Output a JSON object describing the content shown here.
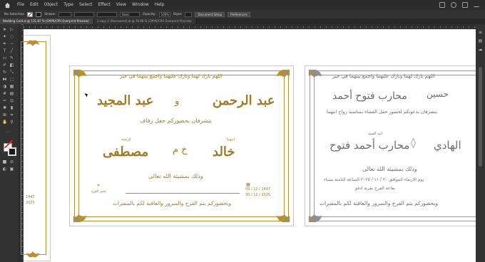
{
  "menubar": {
    "items": [
      "File",
      "Edit",
      "Object",
      "Type",
      "Select",
      "Effect",
      "View",
      "Window",
      "Help"
    ]
  },
  "controlbar": {
    "selection": "No Selection",
    "stroke_label": "Stroke:",
    "style_label": "Basic",
    "opacity_label": "Opacity:",
    "opacity_value": "100%",
    "style2_label": "Style:",
    "doc_setup": "Document Setup",
    "preferences": "Preferences"
  },
  "tabs": [
    "Wedding Card.ai @ 131.87 % (CMYK/CPU Overprint Preview)",
    "3 copy 1 (Recovered).ai @ 76.68 % (CMYK/CPU Overprint Preview)"
  ],
  "card1": {
    "top_verse": "اللهم بارك لهما وبارك عليهما واجمع بينهما في خير",
    "groom_father": "عبد الرحمن",
    "connector": "و",
    "bride_father": "عبد المجيد",
    "invite_line": "يتشرفان بحضوركم حفل زفاف",
    "groom_label": "ابنهما",
    "groom_name": "خالد",
    "bride_label": "كريمته",
    "bride_name": "مصطفى",
    "center_initials": "خ م",
    "blessing": "وذلك بمشيئة الله تعالى",
    "date_hijri": "09 / 12 / 1447",
    "date_greg": "30 / 11 / 2025",
    "location": "قصر الفرح",
    "closing": "وبحضوركم يتم الفرح والسرور والعاقبة لكم بالمسرات"
  },
  "card2": {
    "top_verse": "اللهم بارك لهما وبارك عليهما واجمع بينهما في خير",
    "father1": "محارب فتوح أحمد",
    "father2": "حسين",
    "line1": "يتشرفان بدعوتكم لحضور حفل العشاء بمناسبة زواج ابنهما",
    "groom_label": "ابنه السيد",
    "groom_name": "محارب أحمد فتوح",
    "bride_name": "الهادي",
    "blessing": "وذلك بمشيئة الله تعالى",
    "details": "يوم الاربعاء الموافق ٢٠ / ١١ / ٢٠٢٥ الساعة الثامنة مساء",
    "venue": "بقاعة الفرح بقرية ادفو",
    "closing": "وبحضوركم يتم الفرح والسرور والعاقبة لكم بالمسرات"
  },
  "left_artboard": {
    "date1": "1447",
    "date2": "2025"
  },
  "colors": {
    "gold": "#a57a23",
    "grey": "#6d6d6d",
    "ui_dark": "#323232"
  }
}
